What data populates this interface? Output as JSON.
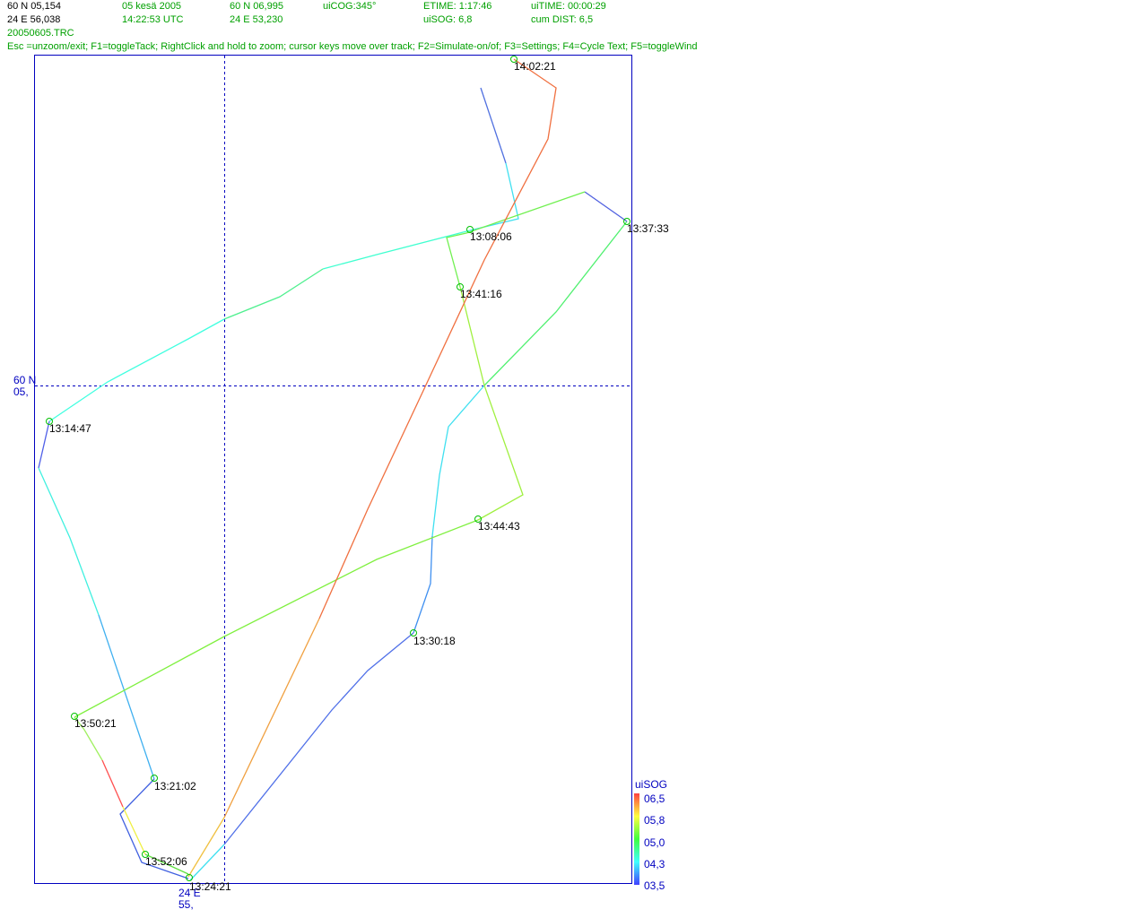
{
  "header": {
    "row1": {
      "lat": "60 N 05,154",
      "date": "05 kesä 2005",
      "cursor_lat": "60 N 06,995",
      "cog": "uiCOG:345°",
      "etime": "ETIME: 1:17:46",
      "uitime": "uiTIME: 00:00:29"
    },
    "row2": {
      "lon": "24 E 56,038",
      "time_utc": "14:22:53 UTC",
      "cursor_lon": "24 E 53,230",
      "sog": "uiSOG: 6,8",
      "cum_dist": "cum DIST: 6,5"
    },
    "file_name": "20050605.TRC",
    "help_text": "Esc =unzoom/exit; F1=toggleTack; RightClick and hold to zoom; cursor keys move over track; F2=Simulate-on/of; F3=Settings; F4=Cycle Text; F5=toggleWind"
  },
  "axes": {
    "lat_label_line1": "60 N",
    "lat_label_line2": "05,",
    "lon_label_line1": "24 E",
    "lon_label_line2": "55,"
  },
  "time_markers": [
    "14:02:21",
    "13:37:33",
    "13:08:06",
    "13:41:16",
    "13:14:47",
    "13:44:43",
    "13:30:18",
    "13:50:21",
    "13:21:02",
    "13:52:06",
    "13:24:21"
  ],
  "legend": {
    "title": "uiSOG",
    "ticks": [
      "06,5",
      "05,8",
      "05,0",
      "04,3",
      "03,5"
    ]
  },
  "colors": {
    "frame": "#0000c0",
    "grid": "#0000c0",
    "marker": "#00c000",
    "header_green": "#00a000"
  }
}
